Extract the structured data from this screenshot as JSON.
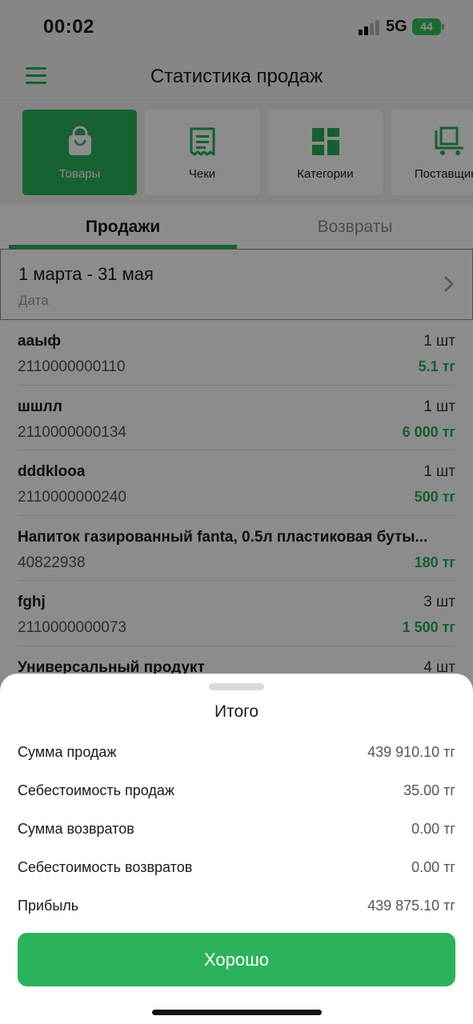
{
  "status_bar": {
    "time": "00:02",
    "network": "5G",
    "battery": "44"
  },
  "header": {
    "title": "Статистика продаж",
    "menu_icon": "hamburger-menu-icon"
  },
  "tiles": [
    {
      "label": "Товары",
      "icon": "shopping-bag-icon",
      "active": true
    },
    {
      "label": "Чеки",
      "icon": "receipt-icon",
      "active": false
    },
    {
      "label": "Категории",
      "icon": "grid-categories-icon",
      "active": false
    },
    {
      "label": "Поставщики",
      "icon": "supplier-cart-icon",
      "active": false
    }
  ],
  "tabs": [
    {
      "label": "Продажи",
      "active": true
    },
    {
      "label": "Возвраты",
      "active": false
    }
  ],
  "date_filter": {
    "range": "1 марта - 31 мая",
    "caption": "Дата"
  },
  "items": [
    {
      "name": "ааыф",
      "code": "2110000000110",
      "qty": "1 шт",
      "sum": "5.1 тг"
    },
    {
      "name": "шшлл",
      "code": "2110000000134",
      "qty": "1 шт",
      "sum": "6 000 тг"
    },
    {
      "name": "dddklooa",
      "code": "2110000000240",
      "qty": "1 шт",
      "sum": "500 тг"
    },
    {
      "name": "Напиток газированный fanta, 0.5л пластиковая буты...",
      "code": "40822938",
      "qty": "",
      "sum": "180 тг"
    },
    {
      "name": "fghj",
      "code": "2110000000073",
      "qty": "3 шт",
      "sum": "1 500 тг"
    },
    {
      "name": "Универсальный продукт",
      "code": "",
      "qty": "4 шт",
      "sum": ""
    }
  ],
  "summary": {
    "title": "Итого",
    "rows": [
      {
        "label": "Сумма продаж",
        "value": "439 910.10 тг"
      },
      {
        "label": "Себестоимость продаж",
        "value": "35.00 тг"
      },
      {
        "label": "Сумма возвратов",
        "value": "0.00 тг"
      },
      {
        "label": "Себестоимость возвратов",
        "value": "0.00 тг"
      },
      {
        "label": "Прибыль",
        "value": "439 875.10 тг"
      }
    ],
    "ok_label": "Хорошо"
  },
  "colors": {
    "accent": "#2bb25c",
    "text": "#1a1a1a",
    "muted": "#8a8a8a"
  }
}
